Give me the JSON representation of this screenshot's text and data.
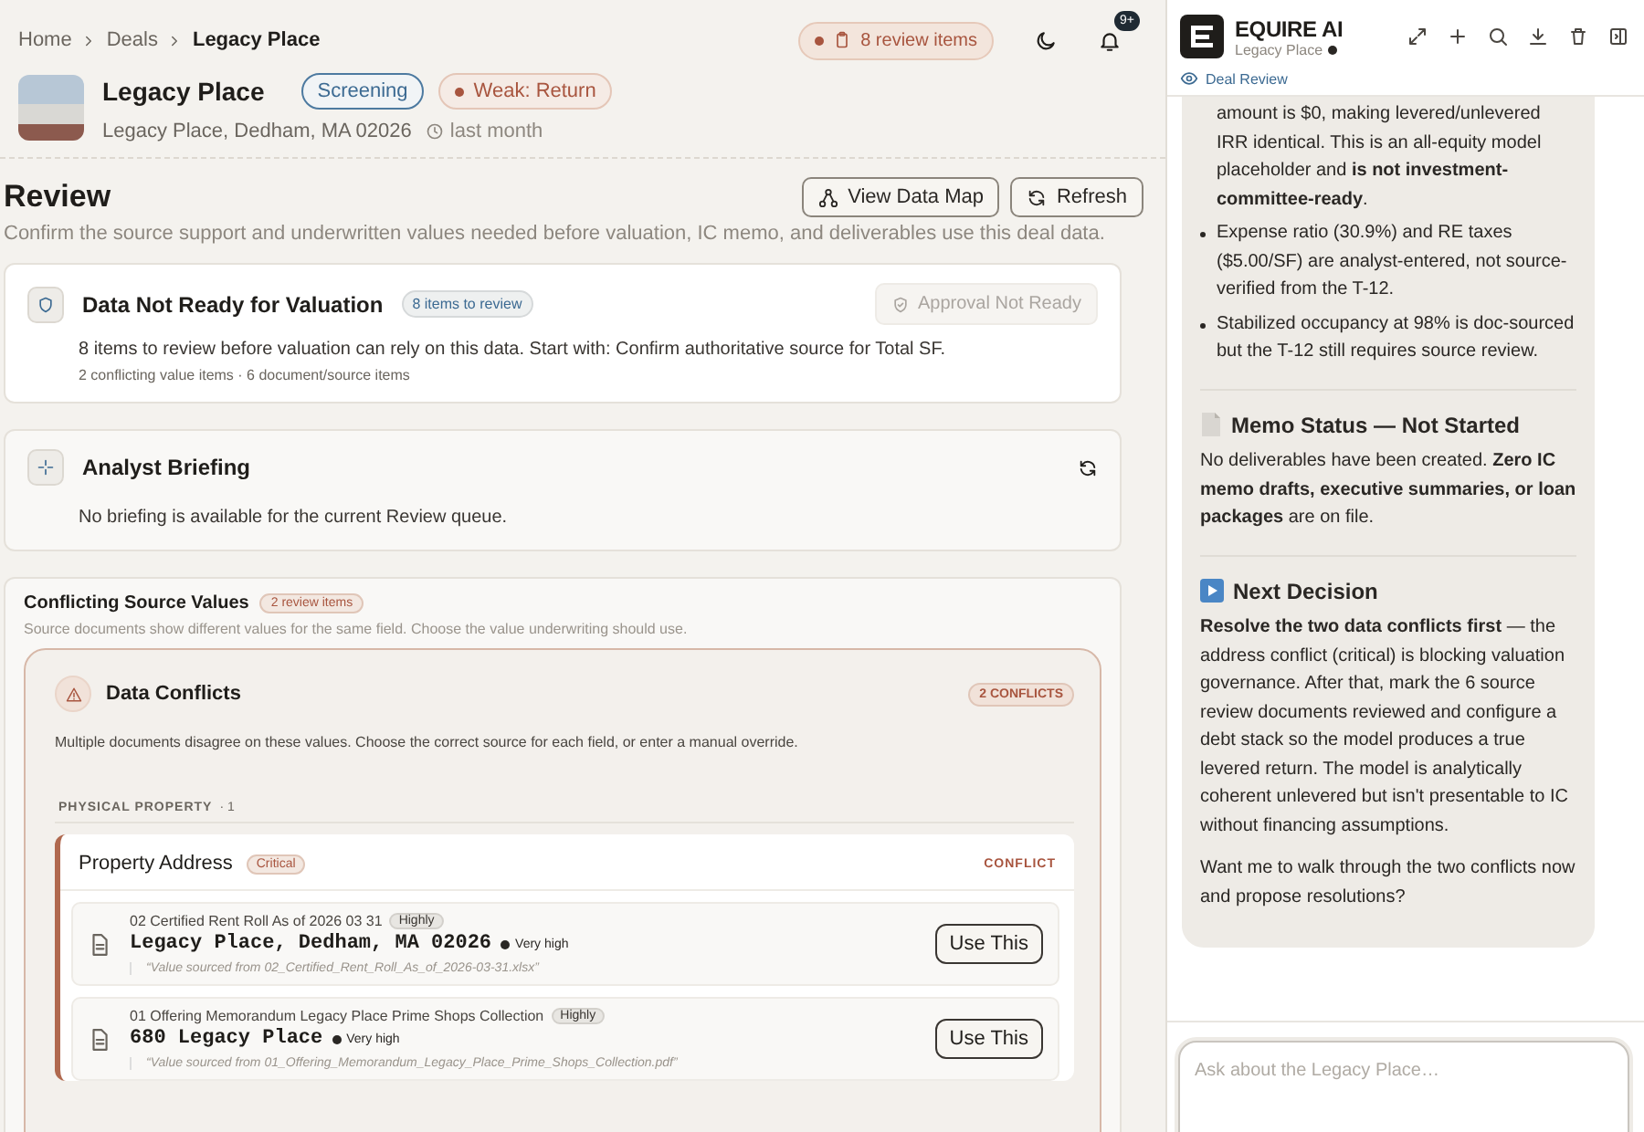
{
  "breadcrumb": [
    {
      "label": "Home",
      "current": false
    },
    {
      "label": "Deals",
      "current": false
    },
    {
      "label": "Legacy Place",
      "current": true
    }
  ],
  "header_actions": {
    "review_pill": "8 review items",
    "notification_badge": "9+"
  },
  "property": {
    "name": "Legacy Place",
    "tags": [
      {
        "label": "Screening",
        "kind": "stage"
      },
      {
        "label": "Weak: Return",
        "kind": "flag"
      }
    ],
    "address": "Legacy Place, Dedham, MA 02026",
    "updated": "last month"
  },
  "review": {
    "title": "Review",
    "subtitle": "Confirm the source support and underwritten values needed before valuation, IC memo, and deliverables use this deal data.",
    "buttons": [
      {
        "label": "View Data Map",
        "kind": "map"
      },
      {
        "label": "Refresh",
        "kind": "refresh"
      }
    ]
  },
  "readiness_card": {
    "title": "Data Not Ready for Valuation",
    "badge": "8 items to review",
    "action": {
      "label": "Approval Not Ready",
      "disabled": true
    },
    "message": "8 items to review before valuation can rely on this data. Start with: Confirm authoritative source for Total SF.",
    "detail": "2 conflicting value items · 6 document/source items"
  },
  "briefing_card": {
    "title": "Analyst Briefing",
    "message": "No briefing is available for the current Review queue."
  },
  "conflicting_section": {
    "title": "Conflicting Source Values",
    "badge": "2 review items",
    "subtitle": "Source documents show different values for the same field. Choose the value underwriting should use.",
    "panel": {
      "title": "Data Conflicts",
      "badge": "2 CONFLICTS",
      "description": "Multiple documents disagree on these values. Choose the correct source for each field, or enter a manual override.",
      "groups": [
        {
          "label": "PHYSICAL PROPERTY",
          "count": "· 1",
          "fields": [
            {
              "name": "Property Address",
              "severity": "Critical",
              "status": "CONFLICT",
              "sources": [
                {
                  "document": "02 Certified Rent Roll As of 2026 03 31",
                  "reliability": "Highly",
                  "value": "Legacy Place, Dedham, MA 02026",
                  "confidence": "Very high",
                  "quote": "“Value sourced from 02_Certified_Rent_Roll_As_of_2026-03-31.xlsx”",
                  "button": "Use This"
                },
                {
                  "document": "01 Offering Memorandum Legacy Place Prime Shops Collection",
                  "reliability": "Highly",
                  "value": "680 Legacy Place",
                  "confidence": "Very high",
                  "quote": "“Value sourced from 01_Offering_Memorandum_Legacy_Place_Prime_Shops_Collection.pdf”",
                  "button": "Use This"
                }
              ]
            }
          ]
        }
      ]
    }
  },
  "assistant": {
    "title": "EQUIRE AI",
    "subtitle": "Legacy Place",
    "mode_link": "Deal Review",
    "bullets": [
      {
        "text": "amount is $0, making levered/unlevered IRR identical. This is an all-equity model placeholder and **is not investment-committee-ready**.",
        "kind": "continued"
      },
      {
        "text": "Expense ratio (30.9%) and RE taxes ($5.00/SF) are analyst-entered, not source-verified from the T-12.",
        "kind": "item"
      },
      {
        "text": "Stabilized occupancy at 98% is doc-sourced but the T-12 still requires source review.",
        "kind": "item"
      }
    ],
    "sections": [
      {
        "kind": "memo",
        "heading": "Memo Status — Not Started",
        "paragraphs": [
          "No deliverables have been created. **Zero IC memo drafts, executive summaries, or loan packages** are on file."
        ]
      },
      {
        "kind": "decision",
        "heading": "Next Decision",
        "paragraphs": [
          "**Resolve the two data conflicts first** — the address conflict (critical) is blocking valuation governance. After that, mark the 6 source review documents reviewed and configure a debt stack so the model produces a true levered return. The model is analytically coherent unlevered but isn't presentable to IC without financing assumptions.",
          "Want me to walk through the two conflicts now and propose resolutions?"
        ]
      }
    ],
    "input": {
      "placeholder": "Ask about the Legacy Place…"
    }
  }
}
